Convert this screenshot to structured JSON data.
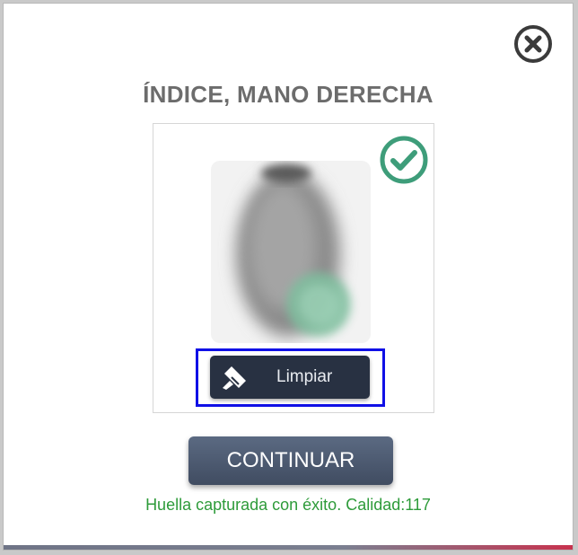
{
  "dialog": {
    "title": "ÍNDICE, MANO DERECHA",
    "close_icon": "close-icon",
    "capture": {
      "status_icon": "check-circle-icon",
      "clear_button_label": "Limpiar",
      "clear_icon": "broom-icon"
    },
    "continue_button_label": "CONTINUAR",
    "status_message": "Huella capturada con éxito. Calidad:117"
  },
  "colors": {
    "accent_green": "#3e9d7a",
    "status_green": "#2e9b3a",
    "dark_button": "#283142",
    "highlight_blue": "#1010e6"
  }
}
